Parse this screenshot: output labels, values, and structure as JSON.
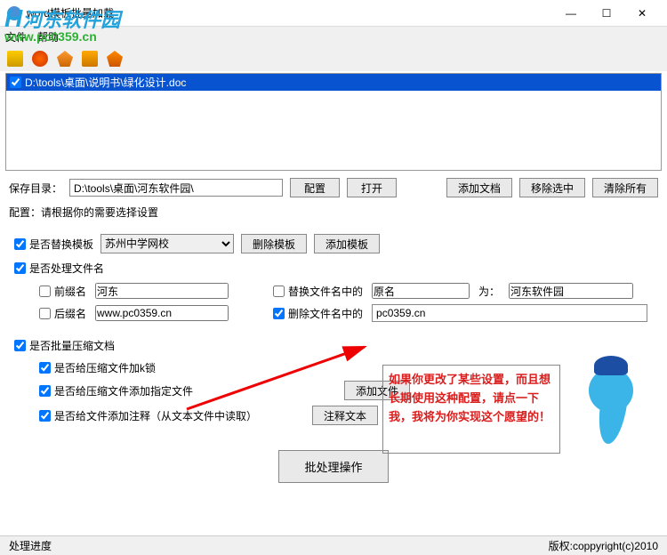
{
  "window": {
    "title": "word模板批量加载",
    "minimize": "—",
    "maximize": "☐",
    "close": "✕"
  },
  "watermark": {
    "brand": "河东软件园",
    "url": "www.pc0359.cn"
  },
  "menu": {
    "file": "文件",
    "help": "帮助"
  },
  "filelist": {
    "items": [
      {
        "path": "D:\\tools\\桌面\\说明书\\绿化设计.doc",
        "checked": true
      }
    ]
  },
  "save": {
    "label": "保存目录：",
    "path": "D:\\tools\\桌面\\河东软件园\\",
    "config_btn": "配置",
    "open_btn": "打开",
    "add_doc_btn": "添加文档",
    "remove_sel_btn": "移除选中",
    "clear_all_btn": "清除所有"
  },
  "config": {
    "title": "配置：请根据你的需要选择设置",
    "replace_template": {
      "label": "是否替换模板",
      "select_value": "苏州中学网校",
      "delete_btn": "删除模板",
      "add_btn": "添加模板"
    },
    "process_filename": {
      "label": "是否处理文件名"
    },
    "prefix": {
      "label": "前缀名",
      "value": "河东"
    },
    "suffix": {
      "label": "后缀名",
      "value": "www.pc0359.cn"
    },
    "replace_in_name": {
      "label": "替换文件名中的",
      "from": "原名",
      "to_label": "为：",
      "to": "河东软件园"
    },
    "delete_in_name": {
      "label": "删除文件名中的",
      "value": "pc0359.cn"
    },
    "batch_compress": {
      "label": "是否批量压缩文档"
    },
    "compress_lock": {
      "label": "是否给压缩文件加k锁"
    },
    "compress_add_file": {
      "label": "是否给压缩文件添加指定文件",
      "btn": "添加文件"
    },
    "compress_comment": {
      "label": "是否给文件添加注释（从文本文件中读取）",
      "btn": "注释文本"
    }
  },
  "message": {
    "text": "如果你更改了某些设置，而且想长期使用这种配置，请点一下我，我将为你实现这个愿望的！"
  },
  "main_button": "批处理操作",
  "status": {
    "left": "处理进度",
    "right": "版权:coppyright(c)2010"
  }
}
